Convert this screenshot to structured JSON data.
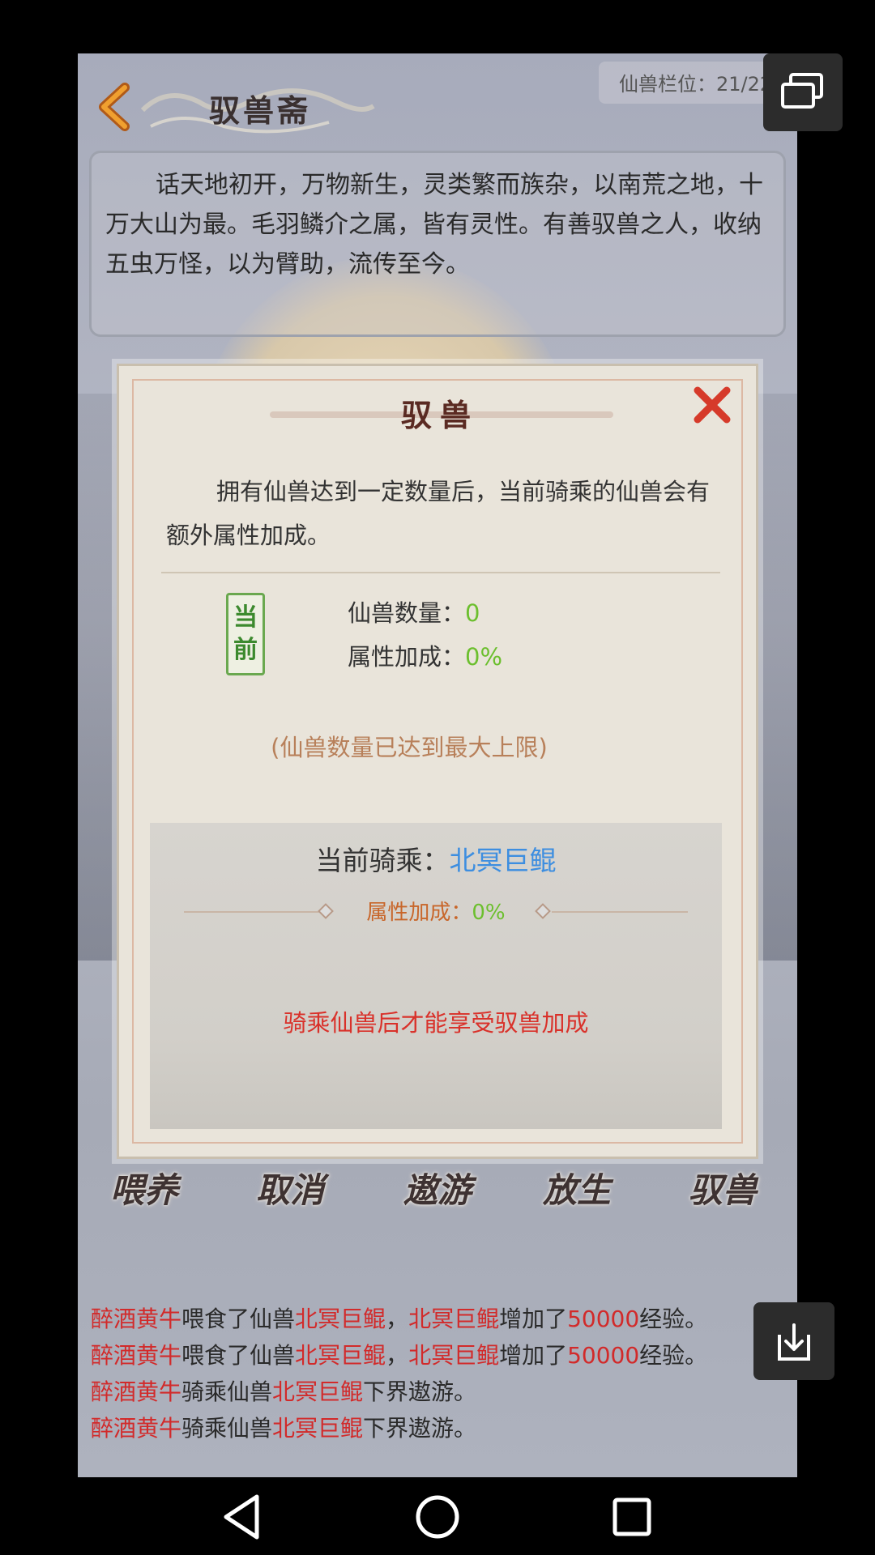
{
  "header": {
    "title": "驭兽斋",
    "slot_label": "仙兽栏位：21/22"
  },
  "story": {
    "text": "话天地初开，万物新生，灵类繁而族杂，以南荒之地，十万大山为最。毛羽鳞介之属，皆有灵性。有善驭兽之人，收纳五虫万怪，以为臂助，流传至今。"
  },
  "dialog": {
    "title": "驭兽",
    "intro": "拥有仙兽达到一定数量后，当前骑乘的仙兽会有额外属性加成。",
    "current_badge": [
      "当",
      "前"
    ],
    "count_label": "仙兽数量：",
    "count_value": "0",
    "bonus_label": "属性加成：",
    "bonus_value": "0%",
    "limit_note": "(仙兽数量已达到最大上限)",
    "ride_label": "当前骑乘：",
    "ride_value": "北冥巨鲲",
    "ride_bonus_label": "属性加成：",
    "ride_bonus_value": "0%",
    "warning": "骑乘仙兽后才能享受驭兽加成"
  },
  "actions": [
    "喂养",
    "取消",
    "遨游",
    "放生",
    "驭兽"
  ],
  "log": [
    {
      "name": "醉酒黄牛",
      "t1": "喂食了仙兽",
      "beast": "北冥巨鲲",
      "t2": "，",
      "beast2": "北冥巨鲲",
      "t3": "增加了",
      "num": "50000",
      "t4": "经验。"
    },
    {
      "name": "醉酒黄牛",
      "t1": "喂食了仙兽",
      "beast": "北冥巨鲲",
      "t2": "，",
      "beast2": "北冥巨鲲",
      "t3": "增加了",
      "num": "50000",
      "t4": "经验。"
    },
    {
      "name": "醉酒黄牛",
      "t1": "骑乘仙兽",
      "beast": "北冥巨鲲",
      "t2": "下界遨游。"
    },
    {
      "name": "醉酒黄牛",
      "t1": "骑乘仙兽",
      "beast": "北冥巨鲲",
      "t2": "下界遨游。"
    }
  ],
  "icons": {
    "back": "chevron-left-icon",
    "close": "close-x-icon",
    "window": "window-switch-icon",
    "download": "download-icon",
    "nav_back": "triangle-back-icon",
    "nav_home": "circle-home-icon",
    "nav_recent": "square-recent-icon"
  },
  "colors": {
    "accent_red": "#d22a2a",
    "value_green": "#6cbf2e",
    "ride_blue": "#3d8ee0",
    "bonus_orange": "#c8662a"
  }
}
